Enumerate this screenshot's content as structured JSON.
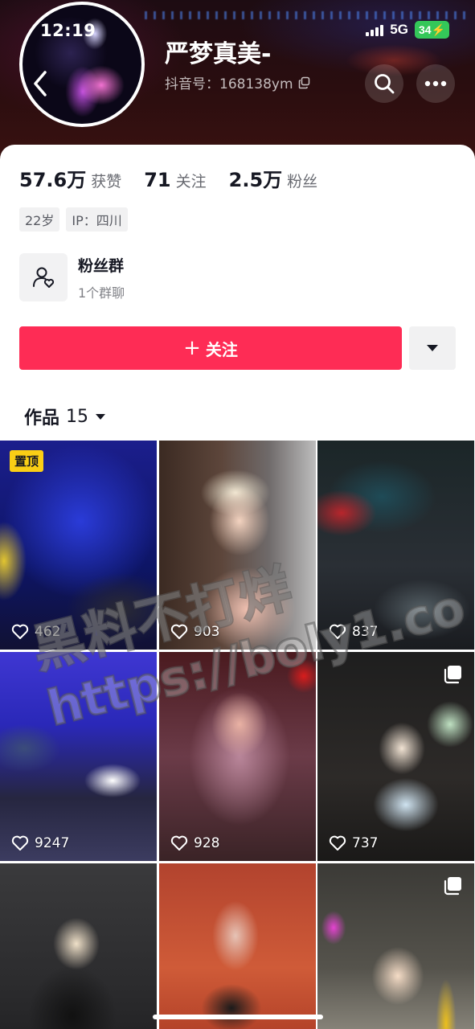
{
  "status_bar": {
    "time": "12:19",
    "network": "5G",
    "battery": "34"
  },
  "profile": {
    "nickname": "严梦真美-",
    "douyin_id": "抖音号：168138ym",
    "stats": [
      {
        "value": "57.6万",
        "label": "获赞"
      },
      {
        "value": "71",
        "label": "关注"
      },
      {
        "value": "2.5万",
        "label": "粉丝"
      }
    ],
    "tags": [
      "22岁",
      "IP：四川"
    ],
    "fan_group": {
      "title": "粉丝群",
      "subtitle": "1个群聊"
    },
    "follow_label": "关注"
  },
  "works_tab": {
    "label": "作品",
    "count": "15"
  },
  "videos": [
    {
      "likes": "462",
      "pinned": "置顶"
    },
    {
      "likes": "903"
    },
    {
      "likes": "837"
    },
    {
      "likes": "9247"
    },
    {
      "likes": "928"
    },
    {
      "likes": "737",
      "multi_image": true
    },
    {
      "likes": ""
    },
    {
      "likes": ""
    },
    {
      "likes": "",
      "multi_image": true
    }
  ],
  "watermark": {
    "line1": "黑料不打烊",
    "line2": "https://boly1.co"
  },
  "colors": {
    "accent": "#fe2c55",
    "pinned_badge": "#face15",
    "battery": "#34c759"
  }
}
